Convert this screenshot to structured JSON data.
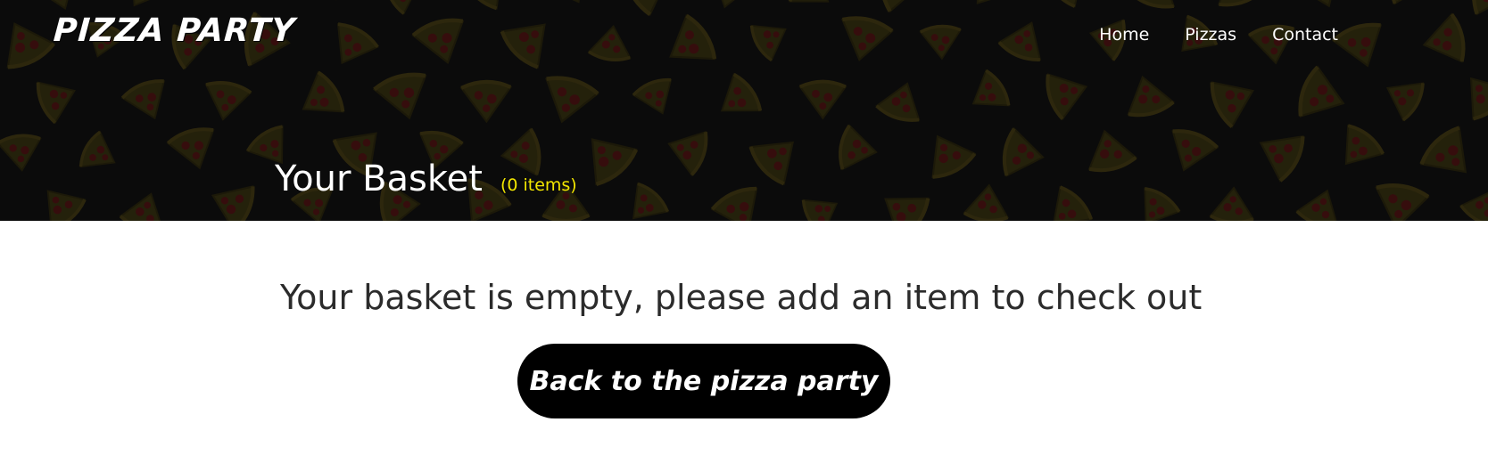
{
  "header": {
    "brand": "PIZZA PARTY",
    "nav": [
      {
        "label": "Home"
      },
      {
        "label": "Pizzas"
      },
      {
        "label": "Contact"
      }
    ],
    "background_pattern": "pizza-slice-pattern",
    "background_color": "#0b0b0b"
  },
  "basket": {
    "title": "Your Basket",
    "count": "(0 items)",
    "count_color": "#f2e600"
  },
  "main": {
    "empty_message": "Your basket is empty, please add an item to check out",
    "back_button_label": "Back to the pizza party"
  }
}
